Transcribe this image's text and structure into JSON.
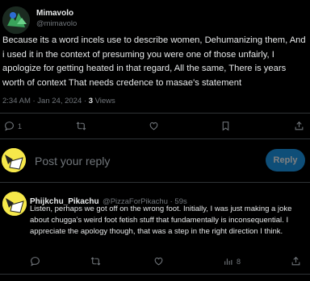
{
  "tweet": {
    "author_name": "Mimavolo",
    "author_handle": "@mimavolo",
    "text": "Because its a word incels use to describe women, Dehumanizing them, And i used it in the context of presuming you were one of those unfairly, I apologize for getting heated in that regard, All the same, There is years worth of context That needs credence to masae's statement",
    "timestamp": "2:34 AM · Jan 24, 2024 · ",
    "views_count": "3",
    "views_label": " Views"
  },
  "actions": {
    "reply_count": "1",
    "retweet_count": "",
    "like_count": "",
    "bookmark_count": ""
  },
  "composer": {
    "placeholder": "Post your reply",
    "button_label": "Reply"
  },
  "reply": {
    "author_name": "Phijkchu_Pikachu",
    "author_handle": "@PizzaForPikachu · 59s",
    "text": "Listen, perhaps we got off on the wrong foot. Initially, I was just making a joke about chugga's weird foot fetish stuff that fundamentally is inconsequential. I appreciate the apology though, that was a step in the right direction I think.",
    "views_count": "8"
  },
  "colors": {
    "background": "#000000",
    "text": "#e7e9ea",
    "muted": "#71767b",
    "accent": "#1d9bf0"
  },
  "icons": [
    "reply-icon",
    "retweet-icon",
    "like-icon",
    "bookmark-icon",
    "share-icon",
    "views-icon"
  ]
}
